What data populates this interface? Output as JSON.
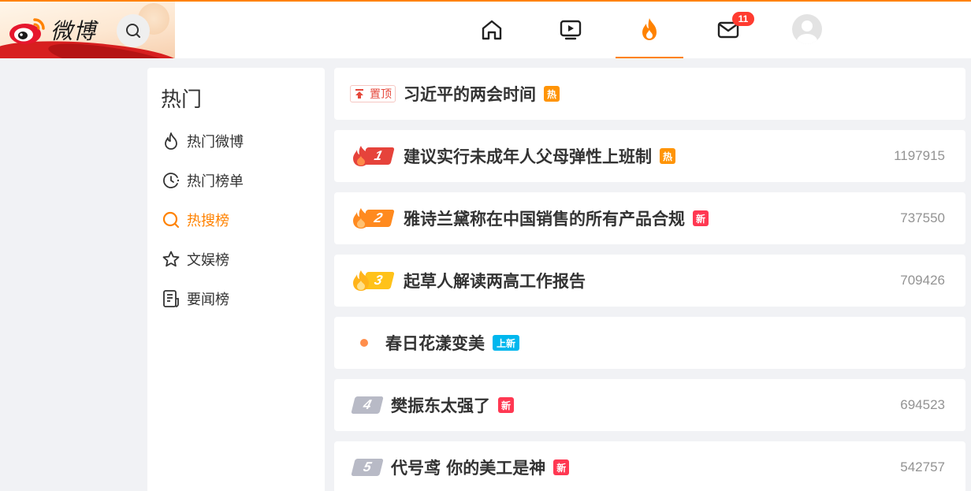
{
  "header": {
    "logo_text": "微博",
    "mail_badge": "11"
  },
  "sidebar": {
    "title": "热门",
    "items": [
      {
        "label": "热门微博",
        "icon": "flame-outline-icon",
        "active": false
      },
      {
        "label": "热门榜单",
        "icon": "clock-icon",
        "active": false
      },
      {
        "label": "热搜榜",
        "icon": "search-hot-icon",
        "active": true
      },
      {
        "label": "文娱榜",
        "icon": "star-icon",
        "active": false
      },
      {
        "label": "要闻榜",
        "icon": "news-icon",
        "active": false
      }
    ]
  },
  "list": {
    "pinned": {
      "tag": "置顶",
      "title": "习近平的两会时间",
      "label": "热"
    },
    "items": [
      {
        "rank": "1",
        "title": "建议实行未成年人父母弹性上班制",
        "label": "热",
        "count": "1197915"
      },
      {
        "rank": "2",
        "title": "雅诗兰黛称在中国销售的所有产品合规",
        "label": "新",
        "count": "737550"
      },
      {
        "rank": "3",
        "title": "起草人解读两高工作报告",
        "label": "",
        "count": "709426"
      },
      {
        "rank": "",
        "title": "春日花漾变美",
        "label": "上新",
        "count": ""
      },
      {
        "rank": "4",
        "title": "樊振东太强了",
        "label": "新",
        "count": "694523"
      },
      {
        "rank": "5",
        "title": "代号鸢 你的美工是神",
        "label": "新",
        "count": "542757"
      }
    ]
  },
  "colors": {
    "accent": "#ff8200",
    "rank1": "#e6433b",
    "rank2": "#ff8a1f",
    "rank3": "#ffc21a",
    "hot_label": "#ff9406",
    "new_label": "#ff3852",
    "up_label": "#00b7ee"
  }
}
